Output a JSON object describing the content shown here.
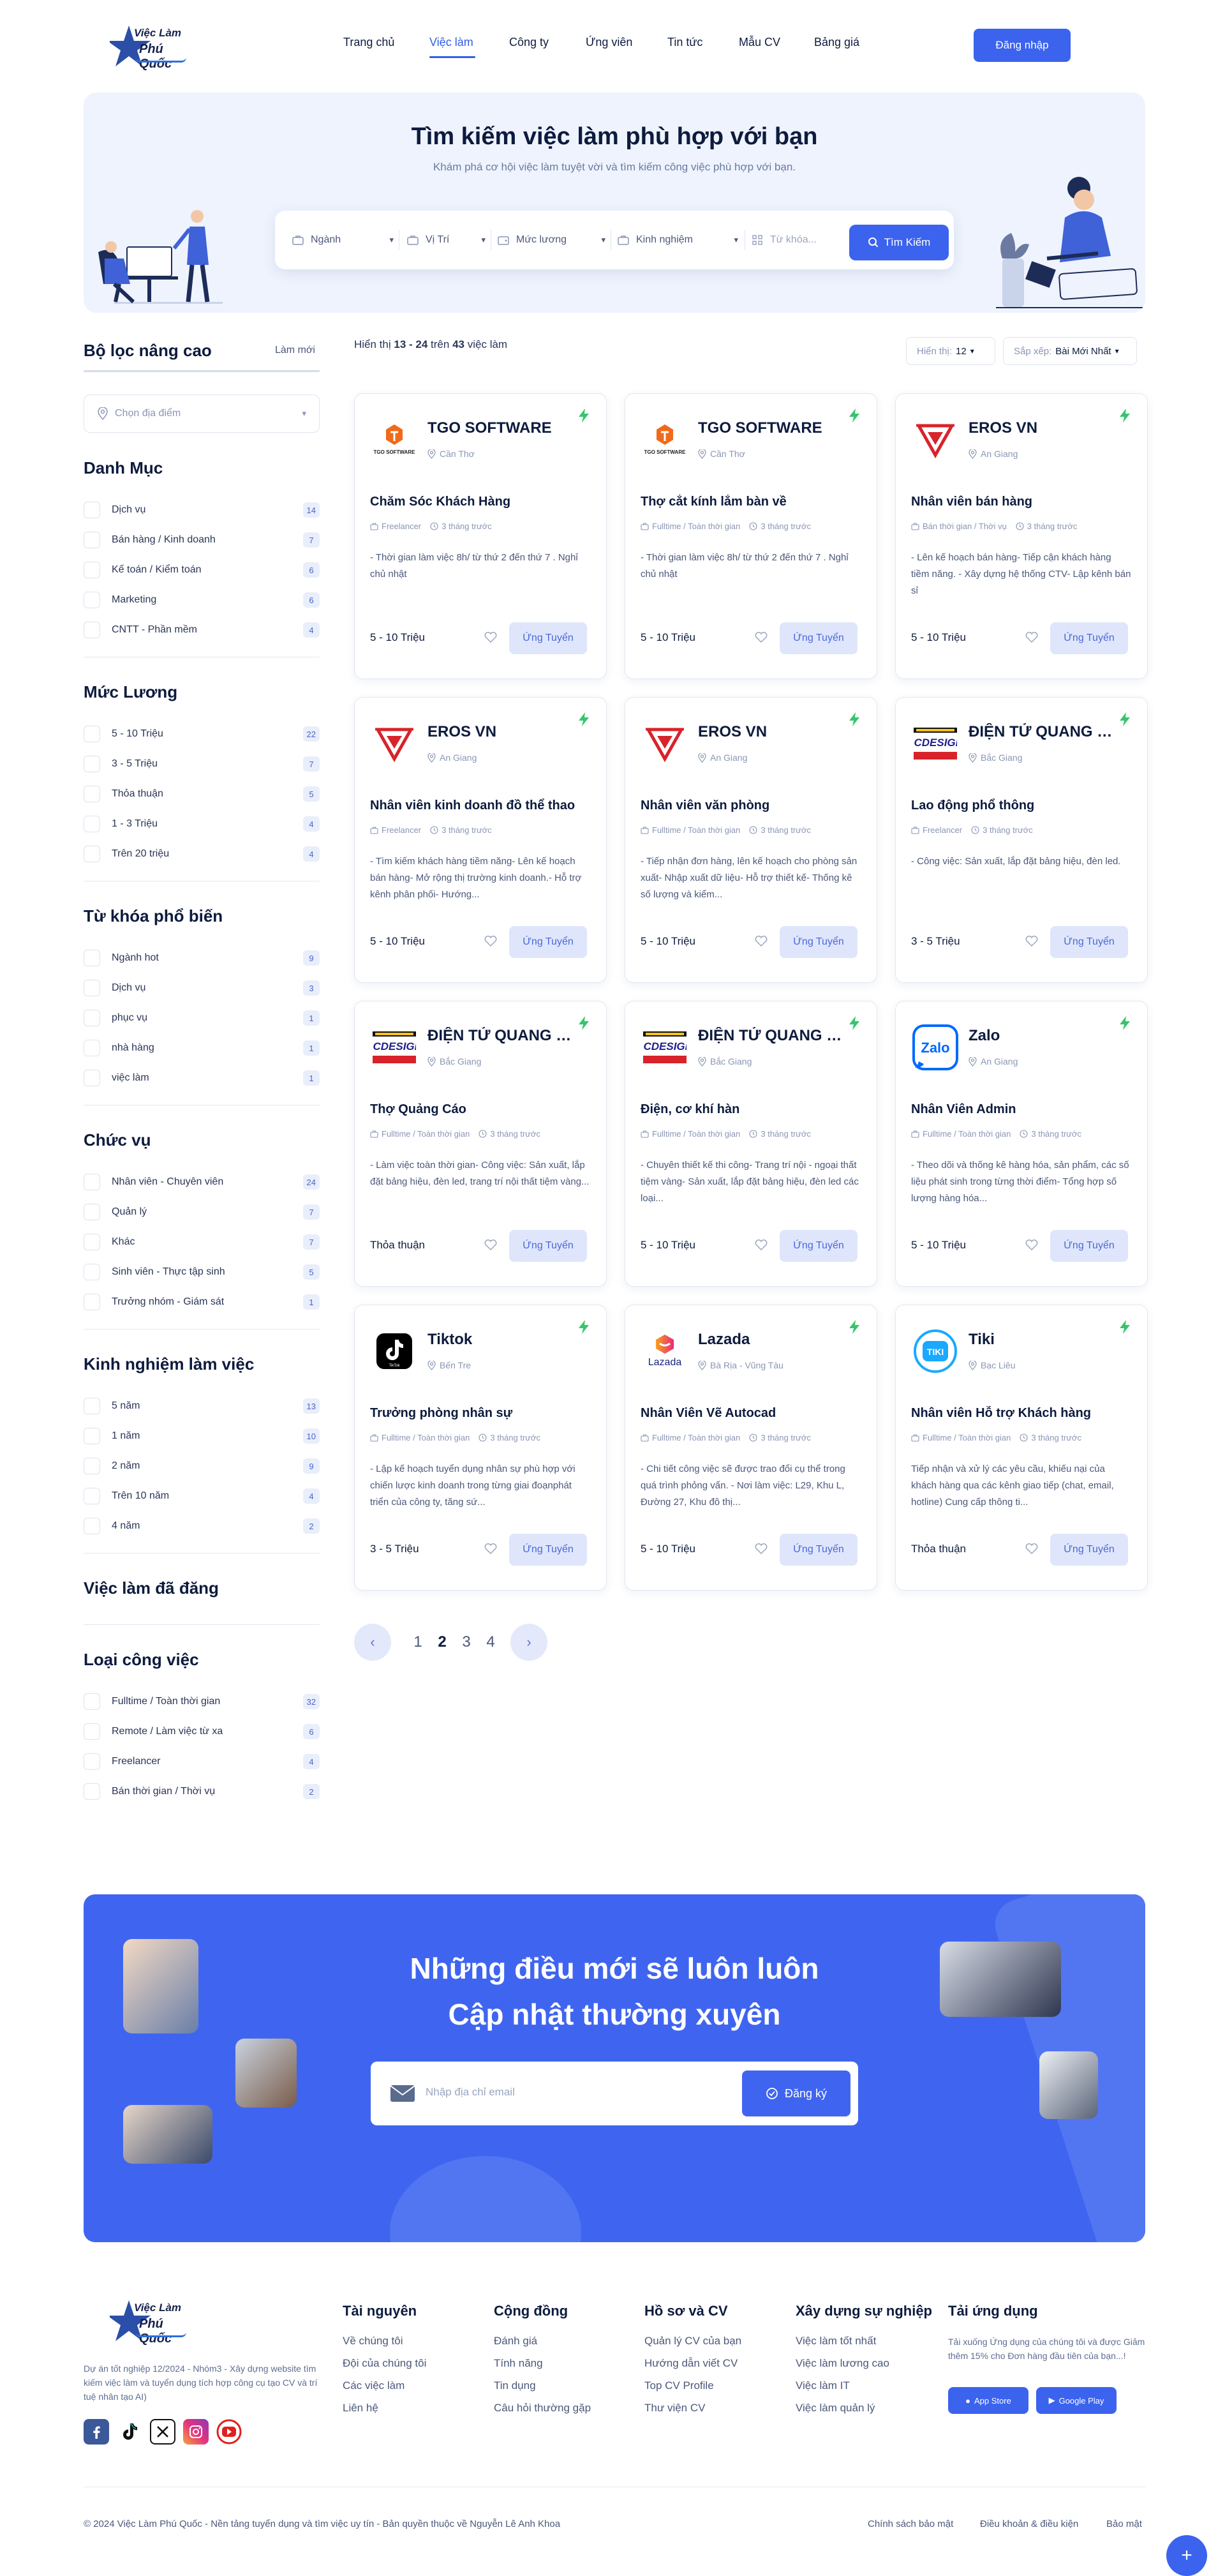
{
  "brand": {
    "line1": "Việc Làm",
    "line2": "Phú Quốc",
    "color": "#3b63ee"
  },
  "nav": {
    "items": [
      "Trang chủ",
      "Việc làm",
      "Công ty",
      "Ứng viên",
      "Tin tức",
      "Mẫu CV",
      "Bảng giá"
    ],
    "active_index": 1,
    "login": "Đăng nhập"
  },
  "hero": {
    "title": "Tìm kiếm việc làm phù hợp với bạn",
    "subtitle": "Khám phá cơ hội việc làm tuyệt vời và tìm kiếm công việc phù hợp với bạn.",
    "filters": [
      "Ngành",
      "Vị Trí",
      "Mức lương",
      "Kinh nghiệm"
    ],
    "search_placeholder": "Từ khóa...",
    "search_button": "Tìm Kiếm"
  },
  "sidebar": {
    "title": "Bộ lọc nâng cao",
    "reset": "Làm mới",
    "location_placeholder": "Chọn địa điểm",
    "groups": [
      {
        "title": "Danh Mục",
        "items": [
          [
            "Dịch vụ",
            "14"
          ],
          [
            "Bán hàng / Kinh doanh",
            "7"
          ],
          [
            "Kế toán / Kiểm toán",
            "6"
          ],
          [
            "Marketing",
            "6"
          ],
          [
            "CNTT - Phần mềm",
            "4"
          ]
        ]
      },
      {
        "title": "Mức Lương",
        "items": [
          [
            "5 - 10 Triệu",
            "22"
          ],
          [
            "3 - 5 Triệu",
            "7"
          ],
          [
            "Thỏa thuận",
            "5"
          ],
          [
            "1 - 3 Triệu",
            "4"
          ],
          [
            "Trên 20 triệu",
            "4"
          ]
        ]
      },
      {
        "title": "Từ khóa phổ biến",
        "items": [
          [
            "Ngành hot",
            "9"
          ],
          [
            "Dịch vụ",
            "3"
          ],
          [
            "phục vụ",
            "1"
          ],
          [
            "nhà hàng",
            "1"
          ],
          [
            "việc làm",
            "1"
          ]
        ]
      },
      {
        "title": "Chức vụ",
        "items": [
          [
            "Nhân viên - Chuyên viên",
            "24"
          ],
          [
            "Quản lý",
            "7"
          ],
          [
            "Khác",
            "7"
          ],
          [
            "Sinh viên - Thực tập sinh",
            "5"
          ],
          [
            "Trưởng nhóm - Giám sát",
            "1"
          ]
        ]
      },
      {
        "title": "Kinh nghiệm làm việc",
        "items": [
          [
            "5 năm",
            "13"
          ],
          [
            "1 năm",
            "10"
          ],
          [
            "2 năm",
            "9"
          ],
          [
            "Trên 10 năm",
            "4"
          ],
          [
            "4 năm",
            "2"
          ]
        ]
      },
      {
        "title": "Việc làm đã đăng",
        "items": []
      },
      {
        "title": "Loại công việc",
        "items": [
          [
            "Fulltime / Toàn thời gian",
            "32"
          ],
          [
            "Remote / Làm việc từ xa",
            "6"
          ],
          [
            "Freelancer",
            "4"
          ],
          [
            "Bán thời gian / Thời vụ",
            "2"
          ]
        ]
      }
    ]
  },
  "results": {
    "showing_prefix": "Hiển thị",
    "range": "13 - 24",
    "of_word": "trên",
    "total": "43",
    "suffix": "việc làm",
    "show_label": "Hiển thị:",
    "show_value": "12",
    "sort_label": "Sắp xếp:",
    "sort_value": "Bài Mới Nhất"
  },
  "jobs": [
    {
      "company": "TGO SOFTWARE",
      "location": "Cần Thơ",
      "logo": "tgo",
      "title": "Chăm Sóc Khách Hàng",
      "type": "Freelancer",
      "time": "3 tháng trước",
      "desc": "- Thời gian làm việc 8h/ từ thứ 2 đến thứ 7 . Nghỉ chủ nhật",
      "salary": "5 - 10 Triệu"
    },
    {
      "company": "TGO SOFTWARE",
      "location": "Cần Thơ",
      "logo": "tgo",
      "title": "Thợ cắt kính lắm bàn về",
      "type": "Fulltime / Toàn thời gian",
      "time": "3 tháng trước",
      "desc": "- Thời gian làm việc 8h/ từ thứ 2 đến thứ 7 . Nghỉ chủ nhật",
      "salary": "5 - 10 Triệu"
    },
    {
      "company": "EROS VN",
      "location": "An Giang",
      "logo": "eros",
      "title": "Nhân viên bán hàng",
      "type": "Bán thời gian / Thời vụ",
      "time": "3 tháng trước",
      "desc": "- Lên kế hoạch bán hàng- Tiếp cận khách hàng tiềm năng. - Xây dựng hệ thống CTV- Lập kênh bán sỉ",
      "salary": "5 - 10 Triệu"
    },
    {
      "company": "EROS VN",
      "location": "An Giang",
      "logo": "eros",
      "title": "Nhân viên kinh doanh đồ thể thao",
      "type": "Freelancer",
      "time": "3 tháng trước",
      "desc": "- Tìm kiếm khách hàng tiềm năng- Lên kế hoạch bán hàng- Mở rộng thị trường kinh doanh.- Hỗ trợ kênh phân phối- Hướng...",
      "salary": "5 - 10 Triệu"
    },
    {
      "company": "EROS VN",
      "location": "An Giang",
      "logo": "eros",
      "title": "Nhân viên văn phòng",
      "type": "Fulltime / Toàn thời gian",
      "time": "3 tháng trước",
      "desc": "- Tiếp nhận đơn hàng, lên kế hoạch cho phòng sản xuất- Nhập xuất dữ liệu- Hỗ trợ thiết kế- Thống kê số lượng và kiểm...",
      "salary": "5 - 10 Triệu"
    },
    {
      "company": "ĐIỆN TỬ QUANG SANG",
      "location": "Bắc Giang",
      "logo": "lcd",
      "title": "Lao động phổ thông",
      "type": "Freelancer",
      "time": "3 tháng trước",
      "desc": "- Công việc: Sản xuất, lắp đặt bảng hiệu, đèn led.",
      "salary": "3 - 5 Triệu"
    },
    {
      "company": "ĐIỆN TỬ QUANG SANG",
      "location": "Bắc Giang",
      "logo": "lcd",
      "title": "Thợ Quảng Cáo",
      "type": "Fulltime / Toàn thời gian",
      "time": "3 tháng trước",
      "desc": "- Làm việc toàn thời gian- Công việc: Sản xuất, lắp đặt bảng hiệu, đèn led, trang trí nội thất tiệm vàng...",
      "salary": "Thỏa thuận"
    },
    {
      "company": "ĐIỆN TỬ QUANG SANG",
      "location": "Bắc Giang",
      "logo": "lcd",
      "title": "Điện, cơ khí hàn",
      "type": "Fulltime / Toàn thời gian",
      "time": "3 tháng trước",
      "desc": "- Chuyên thiết kế thi công- Trang trí nội - ngoại thất tiệm vàng- Sản xuất, lắp đặt bảng hiệu, đèn led các loại...",
      "salary": "5 - 10 Triệu"
    },
    {
      "company": "Zalo",
      "location": "An Giang",
      "logo": "zalo",
      "title": "Nhân Viên Admin",
      "type": "Fulltime / Toàn thời gian",
      "time": "3 tháng trước",
      "desc": "- Theo dõi và thống kê hàng hóa, sản phẩm, các số liệu phát sinh trong từng thời điểm- Tổng hợp số lượng hàng hóa...",
      "salary": "5 - 10 Triệu"
    },
    {
      "company": "Tiktok",
      "location": "Bến Tre",
      "logo": "tiktok",
      "title": "Trưởng phòng nhân sự",
      "type": "Fulltime / Toàn thời gian",
      "time": "3 tháng trước",
      "desc": "- Lập kế hoạch tuyển dụng nhân sự phù hợp với chiến lược kinh doanh trong từng giai đoạnphát triển của công ty, tăng sứ...",
      "salary": "3 - 5 Triệu"
    },
    {
      "company": "Lazada",
      "location": "Bà Rịa - Vũng Tàu",
      "logo": "lazada",
      "title": "Nhân Viên Vẽ Autocad",
      "type": "Fulltime / Toàn thời gian",
      "time": "3 tháng trước",
      "desc": "- Chi tiết công việc sẽ được trao đổi cụ thể trong quá trình phỏng vấn. - Nơi làm việc: L29, Khu L, Đường 27, Khu đô thị...",
      "salary": "5 - 10 Triệu"
    },
    {
      "company": "Tiki",
      "location": "Bạc Liêu",
      "logo": "tiki",
      "title": "Nhân viên Hỗ trợ Khách hàng",
      "type": "Fulltime / Toàn thời gian",
      "time": "3 tháng trước",
      "desc": "Tiếp nhận và xử lý các yêu cầu, khiếu nại của khách hàng qua các kênh giao tiếp (chat, email, hotline) Cung cấp thông ti...",
      "salary": "Thỏa thuận"
    }
  ],
  "apply_label": "Ứng Tuyển",
  "pagination": {
    "pages": [
      "1",
      "2",
      "3",
      "4"
    ],
    "current": "2"
  },
  "newsletter": {
    "line1": "Những điều mới sẽ luôn luôn",
    "line2": "Cập nhật thường xuyên",
    "placeholder": "Nhập địa chỉ email",
    "button": "Đăng ký"
  },
  "footer": {
    "description": "Dự án tốt nghiệp 12/2024 - Nhóm3 - Xây dựng website tìm kiếm việc làm và tuyển dụng tích hợp công cụ tạo CV và trí tuệ nhân tạo AI)",
    "columns": [
      {
        "title": "Tài nguyên",
        "links": [
          "Về chúng tôi",
          "Đội của chúng tôi",
          "Các việc làm",
          "Liên hệ"
        ]
      },
      {
        "title": "Cộng đồng",
        "links": [
          "Đánh giá",
          "Tính năng",
          "Tin dụng",
          "Câu hỏi thường gặp"
        ]
      },
      {
        "title": "Hồ sơ và CV",
        "links": [
          "Quản lý CV của bạn",
          "Hướng dẫn viết CV",
          "Top CV Profile",
          "Thư viện CV"
        ]
      },
      {
        "title": "Xây dựng sự nghiệp",
        "links": [
          "Việc làm tốt nhất",
          "Việc làm lương cao",
          "Việc làm IT",
          "Việc làm quản lý"
        ]
      }
    ],
    "app": {
      "title": "Tải ứng dụng",
      "text": "Tải xuống Ứng dụng của chúng tôi và được Giảm thêm 15% cho Đơn hàng đầu tiên của bạn...!",
      "app_store": "App Store",
      "google_play": "Google Play"
    },
    "copyright": "© 2024 Việc Làm Phú Quốc - Nền tảng tuyển dụng và tìm việc uy tín - Bản quyền thuộc về Nguyễn Lê Anh Khoa",
    "bottom_links": [
      "Chính sách bảo mật",
      "Điều khoản & điều kiện",
      "Bảo mật"
    ]
  }
}
